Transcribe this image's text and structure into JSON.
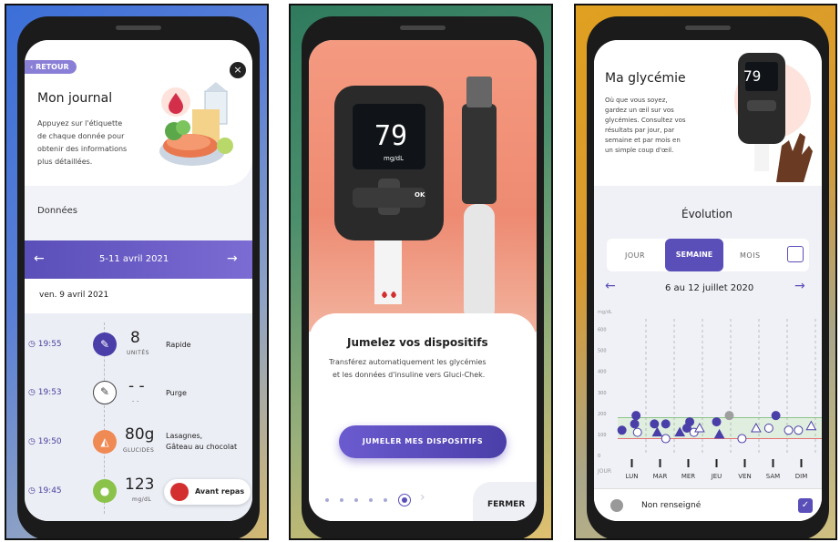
{
  "journal": {
    "back_label": "‹ RETOUR",
    "close_icon": "×",
    "title": "Mon journal",
    "intro": [
      "Appuyez sur l'étiquette",
      "de chaque donnée pour",
      "obtenir des informations",
      "plus détaillées."
    ],
    "section": "Données",
    "week": "5-11 avril 2021",
    "day": "ven. 9 avril 2021",
    "entries": [
      {
        "time": "19:55",
        "value": "8",
        "unit": "UNITÉS",
        "label": "Rapide",
        "icon": "insulin-pen-icon",
        "color": "#4a3ea8"
      },
      {
        "time": "19:53",
        "value": "- -",
        "unit": "- -",
        "label": "Purge",
        "icon": "insulin-pen-icon",
        "color": "#ffffff"
      },
      {
        "time": "19:50",
        "value": "80g",
        "unit": "GLUCIDES",
        "label": "Lasagnes,",
        "label2": "Gâteau au chocolat",
        "icon": "pizza-icon",
        "color": "#f08a55"
      },
      {
        "time": "19:45",
        "value": "123",
        "unit": "mg/dL",
        "label": "",
        "icon": "blood-drop-icon",
        "color": "#8bc34a"
      }
    ],
    "badge": "Avant repas"
  },
  "pairing": {
    "meter_value": "79",
    "meter_unit": "mg/dL",
    "ok": "OK",
    "title": "Jumelez vos dispositifs",
    "desc": [
      "Transférez automatiquement les glycémies",
      "et les données d'insuline vers Gluci-Chek."
    ],
    "button": "JUMELER MES DISPOSITIFS",
    "close": "FERMER",
    "next_icon": "›"
  },
  "glycemia": {
    "title": "Ma glycémie",
    "intro": [
      "Où que vous soyez,",
      "gardez un œil sur vos",
      "glycémies. Consultez vos",
      "résultats par jour, par",
      "semaine et par mois en",
      "un simple coup d'œil."
    ],
    "meter_value": "79",
    "section": "Évolution",
    "tabs": [
      "JOUR",
      "SEMAINE",
      "MOIS"
    ],
    "range": "6 au 12 juillet 2020",
    "unit_label": "mg/dL",
    "day_label": "JOUR",
    "bottom": "Non renseigné"
  },
  "chart_data": {
    "type": "scatter",
    "categories": [
      "LUN",
      "MAR",
      "MER",
      "JEU",
      "VEN",
      "SAM",
      "DIM"
    ],
    "yticks": [
      0,
      100,
      200,
      300,
      400,
      500,
      600
    ],
    "ylim": [
      0,
      650
    ],
    "target_range": [
      80,
      180
    ],
    "points": [
      {
        "day": 0,
        "offset": -0.35,
        "y": 120,
        "shape": "filled-circle"
      },
      {
        "day": 0,
        "offset": 0.15,
        "y": 190,
        "shape": "filled-circle"
      },
      {
        "day": 0,
        "offset": 0.1,
        "y": 150,
        "shape": "filled-circle"
      },
      {
        "day": 0,
        "offset": 0.2,
        "y": 110,
        "shape": "open-circle"
      },
      {
        "day": 1,
        "offset": -0.2,
        "y": 150,
        "shape": "filled-circle"
      },
      {
        "day": 1,
        "offset": 0.2,
        "y": 150,
        "shape": "filled-circle"
      },
      {
        "day": 1,
        "offset": -0.1,
        "y": 110,
        "shape": "filled-triangle"
      },
      {
        "day": 1,
        "offset": 0.2,
        "y": 80,
        "shape": "open-circle"
      },
      {
        "day": 2,
        "offset": -0.3,
        "y": 110,
        "shape": "filled-triangle"
      },
      {
        "day": 2,
        "offset": 0.05,
        "y": 160,
        "shape": "filled-circle"
      },
      {
        "day": 2,
        "offset": -0.05,
        "y": 130,
        "shape": "filled-circle"
      },
      {
        "day": 2,
        "offset": 0.2,
        "y": 110,
        "shape": "open-circle"
      },
      {
        "day": 2,
        "offset": 0.4,
        "y": 130,
        "shape": "open-triangle"
      },
      {
        "day": 3,
        "offset": 0.0,
        "y": 160,
        "shape": "filled-circle"
      },
      {
        "day": 3,
        "offset": 0.1,
        "y": 100,
        "shape": "filled-triangle"
      },
      {
        "day": 3,
        "offset": 0.45,
        "y": 190,
        "shape": "grey-circle"
      },
      {
        "day": 4,
        "offset": -0.1,
        "y": 80,
        "shape": "open-circle"
      },
      {
        "day": 4,
        "offset": 0.4,
        "y": 130,
        "shape": "open-triangle"
      },
      {
        "day": 5,
        "offset": -0.15,
        "y": 130,
        "shape": "open-circle"
      },
      {
        "day": 5,
        "offset": 0.1,
        "y": 190,
        "shape": "filled-circle"
      },
      {
        "day": 5,
        "offset": 0.55,
        "y": 120,
        "shape": "open-circle"
      },
      {
        "day": 6,
        "offset": -0.1,
        "y": 120,
        "shape": "open-circle"
      },
      {
        "day": 6,
        "offset": 0.35,
        "y": 140,
        "shape": "open-triangle"
      }
    ]
  }
}
